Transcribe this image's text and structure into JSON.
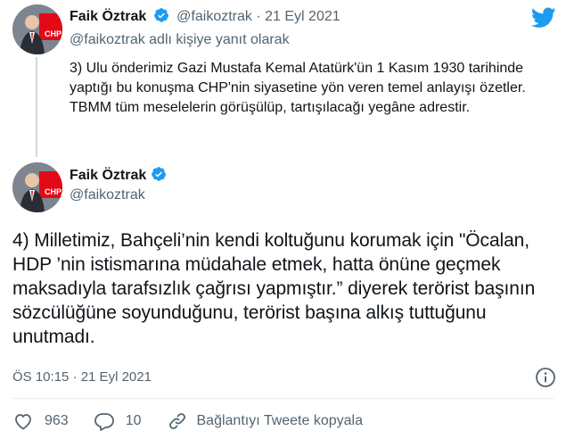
{
  "parent": {
    "name": "Faik Öztrak",
    "handle": "@faikoztrak",
    "separator": "·",
    "date": "21 Eyl 2021",
    "reply_to": "@faikoztrak adlı kişiye yanıt olarak",
    "text": "3) Ulu önderimiz Gazi Mustafa Kemal Atatürk'ün 1 Kasım 1930 tarihinde yaptığı bu konuşma CHP'nin siyasetine yön veren temel anlayışı özetler. TBMM tüm meselelerin görüşülüp, tartışılacağı yegâne adrestir."
  },
  "main": {
    "name": "Faik Öztrak",
    "handle": "@faikoztrak",
    "text": "4) Milletimiz, Bahçeli’nin kendi koltuğunu korumak için \"Öcalan, HDP ’nin istismarına müdahale etmek, hatta önüne geçmek maksadıyla tarafsızlık çağrısı yapmıştır.” diyerek terörist başının sözcülüğüne soyunduğunu, terörist başına alkış tuttuğunu unutmadı.",
    "timestamp": "ÖS 10:15 · 21 Eyl 2021"
  },
  "actions": {
    "likes": "963",
    "replies": "10",
    "copy_link": "Bağlantıyı Tweete kopyala"
  },
  "colors": {
    "twitter_blue": "#1d9bf0",
    "text": "#0f1419",
    "muted": "#536471",
    "chp_red": "#e30a17"
  },
  "icons": {
    "bird": "twitter-bird-icon",
    "verified": "verified-badge-icon",
    "info": "info-icon",
    "like": "heart-icon",
    "reply": "reply-bubble-icon",
    "link": "link-icon"
  }
}
